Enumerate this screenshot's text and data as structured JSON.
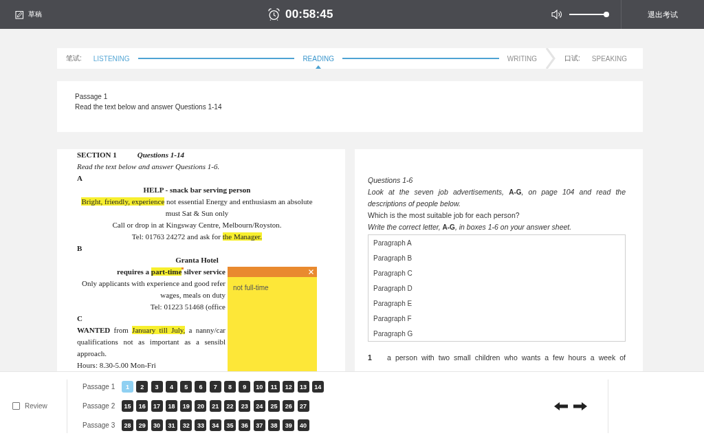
{
  "top_bar": {
    "draft_label": "草稿",
    "timer": "00:58:45",
    "volume": {
      "level": 0.95
    },
    "exit_label": "退出考试"
  },
  "progress": {
    "groups": [
      {
        "label": "笔试:",
        "steps": [
          {
            "name": "LISTENING",
            "completed": true,
            "selected": false
          },
          {
            "name": "READING",
            "completed": false,
            "selected": true
          },
          {
            "name": "WRITING",
            "completed": false,
            "selected": false
          }
        ]
      },
      {
        "label": "口试:",
        "steps": [
          {
            "name": "SPEAKING",
            "completed": false,
            "selected": false
          }
        ]
      }
    ]
  },
  "passage_header": {
    "title": "Passage 1",
    "instruction": "Read the text below and answer Questions 1-14"
  },
  "passage": {
    "lines": [
      {
        "kind": "section-heading",
        "segments": [
          {
            "text": "SECTION 1",
            "highlighted": false
          },
          {
            "text": "*Questions 1-14*",
            "highlighted": false
          }
        ]
      },
      {
        "kind": "instruction",
        "segments": [
          {
            "text": "Read the text below and answer Questions 1-6.",
            "highlighted": false
          }
        ]
      },
      {
        "kind": "letter",
        "segments": [
          {
            "text": "A",
            "highlighted": false
          }
        ]
      },
      {
        "kind": "title",
        "segments": [
          {
            "text": "HELP - snack bar serving person",
            "highlighted": false
          }
        ]
      },
      {
        "kind": "centered",
        "segments": [
          {
            "text": "Bright, friendly, experience",
            "highlighted": true,
            "annotated": false
          },
          {
            "text": " not essential Energy and enthusiasm an absolute",
            "highlighted": false
          }
        ]
      },
      {
        "kind": "centered",
        "segments": [
          {
            "text": "must Sat & Sun only",
            "highlighted": false
          }
        ]
      },
      {
        "kind": "centered",
        "segments": [
          {
            "text": "Call or drop in at Kingsway Centre, Melbourn/Royston.",
            "highlighted": false
          }
        ]
      },
      {
        "kind": "centered",
        "segments": [
          {
            "text": "Tel: 01763 24272 and ask for ",
            "highlighted": false
          },
          {
            "text": "the Manager.",
            "highlighted": true,
            "annotated": false
          }
        ]
      },
      {
        "kind": "letter",
        "segments": [
          {
            "text": "B",
            "highlighted": false
          }
        ]
      },
      {
        "kind": "title",
        "segments": [
          {
            "text": "Granta Hotel",
            "highlighted": false
          }
        ]
      },
      {
        "kind": "title-cut",
        "segments": [
          {
            "text": "requires a ",
            "highlighted": false
          },
          {
            "text": "part-time",
            "highlighted": true,
            "annotated": true
          },
          {
            "text": "silver service",
            "highlighted": false
          }
        ]
      },
      {
        "kind": "centered-cut",
        "segments": [
          {
            "text": "Only applicants with experience and good refer",
            "highlighted": false
          }
        ]
      },
      {
        "kind": "centered-cut",
        "segments": [
          {
            "text": "wages, meals on duty",
            "highlighted": false
          }
        ]
      },
      {
        "kind": "centered-cut",
        "segments": [
          {
            "text": "Tel: 01223 51468 (office",
            "highlighted": false
          }
        ]
      },
      {
        "kind": "letter",
        "segments": [
          {
            "text": "C",
            "highlighted": false
          }
        ]
      },
      {
        "kind": "paragraph-cut",
        "segments": [
          {
            "text": "**WANTED** from ",
            "highlighted": false
          },
          {
            "text": "January till July,",
            "highlighted": true,
            "annotated": false
          },
          {
            "text": " a nanny/car",
            "highlighted": false
          }
        ]
      },
      {
        "kind": "paragraph-cut",
        "segments": [
          {
            "text": "qualifications not as important as a sensibl",
            "highlighted": false
          }
        ]
      },
      {
        "kind": "plain",
        "segments": [
          {
            "text": "approach.",
            "highlighted": false
          }
        ]
      },
      {
        "kind": "plain",
        "segments": [
          {
            "text": "Hours: 8.30-5.00 Mon-Fri",
            "highlighted": false
          }
        ]
      }
    ]
  },
  "sticky_note": {
    "text": "not full-time"
  },
  "questions": {
    "title": "Questions 1-6",
    "intro": "Look at the seven job advertisements, **A-G**, on page 104 and read the descriptions of people below.",
    "prompt": "Which is the most suitable job for each person?",
    "instruction": "Write the correct letter, **A-G**, in boxes 1-6 on your answer sheet.",
    "options": [
      "Paragraph A",
      "Paragraph B",
      "Paragraph C",
      "Paragraph D",
      "Paragraph E",
      "Paragraph F",
      "Paragraph G"
    ],
    "items": [
      {
        "number": "1",
        "text": "a person with two small children who wants a few hours a week of"
      }
    ]
  },
  "navigator": {
    "review": {
      "label": "Review",
      "checked": false
    },
    "passages": [
      {
        "label": "Passage 1",
        "questions": [
          {
            "number": "1",
            "selected": true
          },
          {
            "number": "2",
            "selected": false
          },
          {
            "number": "3",
            "selected": false
          },
          {
            "number": "4",
            "selected": false
          },
          {
            "number": "5",
            "selected": false
          },
          {
            "number": "6",
            "selected": false
          },
          {
            "number": "7",
            "selected": false
          },
          {
            "number": "8",
            "selected": false
          },
          {
            "number": "9",
            "selected": false
          },
          {
            "number": "10",
            "selected": false
          },
          {
            "number": "11",
            "selected": false
          },
          {
            "number": "12",
            "selected": false
          },
          {
            "number": "13",
            "selected": false
          },
          {
            "number": "14",
            "selected": false
          }
        ]
      },
      {
        "label": "Passage 2",
        "questions": [
          {
            "number": "15",
            "selected": false
          },
          {
            "number": "16",
            "selected": false
          },
          {
            "number": "17",
            "selected": false
          },
          {
            "number": "18",
            "selected": false
          },
          {
            "number": "19",
            "selected": false
          },
          {
            "number": "20",
            "selected": false
          },
          {
            "number": "21",
            "selected": false
          },
          {
            "number": "22",
            "selected": false
          },
          {
            "number": "23",
            "selected": false
          },
          {
            "number": "24",
            "selected": false
          },
          {
            "number": "25",
            "selected": false
          },
          {
            "number": "26",
            "selected": false
          },
          {
            "number": "27",
            "selected": false
          }
        ]
      },
      {
        "label": "Passage 3",
        "questions": [
          {
            "number": "28",
            "selected": false
          },
          {
            "number": "29",
            "selected": false
          },
          {
            "number": "30",
            "selected": false
          },
          {
            "number": "31",
            "selected": false
          },
          {
            "number": "32",
            "selected": false
          },
          {
            "number": "33",
            "selected": false
          },
          {
            "number": "34",
            "selected": false
          },
          {
            "number": "35",
            "selected": false
          },
          {
            "number": "36",
            "selected": false
          },
          {
            "number": "37",
            "selected": false
          },
          {
            "number": "38",
            "selected": false
          },
          {
            "number": "39",
            "selected": false
          },
          {
            "number": "40",
            "selected": false
          }
        ]
      }
    ]
  }
}
